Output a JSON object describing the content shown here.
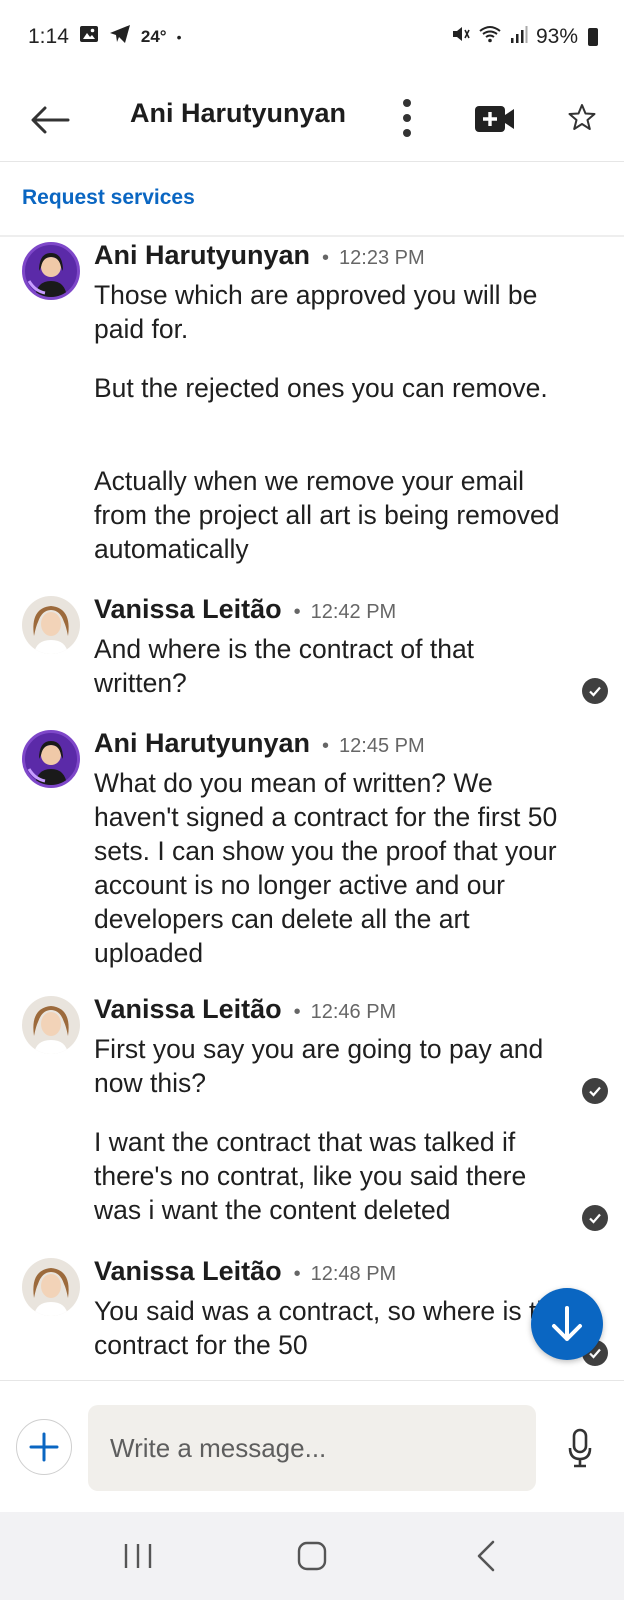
{
  "status_bar": {
    "time": "1:14",
    "temperature": "24°",
    "dot": "•",
    "battery": "93%",
    "icons": [
      "gallery-icon",
      "telegram-icon",
      "mute-icon",
      "wifi-icon",
      "signal-icon",
      "battery-icon"
    ]
  },
  "header": {
    "title": "Ani Harutyunyan",
    "icons": [
      "back-arrow-icon",
      "more-vertical-icon",
      "video-call-icon",
      "star-icon"
    ]
  },
  "request_services": "Request services",
  "messages": [
    {
      "sender": "Ani Harutyunyan",
      "time": "12:23 PM",
      "separator": "•",
      "paragraphs": [
        "Those which are approved you will be paid for.",
        "But the rejected ones you can remove.",
        "Actually when we remove your email from the project all art is being removed automatically"
      ]
    },
    {
      "sender": "Vanissa Leitão",
      "time": "12:42 PM",
      "separator": "•",
      "paragraphs": [
        "And where is the contract of that written?"
      ]
    },
    {
      "sender": "Ani Harutyunyan",
      "time": "12:45 PM",
      "separator": "•",
      "paragraphs": [
        "What do you mean of written? We haven't signed a contract for the first 50 sets. I can show you the proof that your account is no longer active and our developers can delete all the art uploaded"
      ]
    },
    {
      "sender": "Vanissa Leitão",
      "time": "12:46 PM",
      "separator": "•",
      "paragraphs": [
        "First you say you are going to pay and now this?",
        "I want the contract that was talked if there's no contrat, like you said there was i want the content deleted"
      ]
    },
    {
      "sender": "Vanissa Leitão",
      "time": "12:48 PM",
      "separator": "•",
      "paragraphs": [
        "You said was a contract, so where is the contract for the 50"
      ]
    }
  ],
  "composer": {
    "placeholder": "Write a message...",
    "icons": [
      "plus-icon",
      "microphone-icon"
    ]
  },
  "colors": {
    "accent": "#0a66c2",
    "text": "#1f1f1f",
    "muted": "#666666",
    "input_bg": "#f1efeb",
    "nav_bg": "#f2f2f4"
  }
}
